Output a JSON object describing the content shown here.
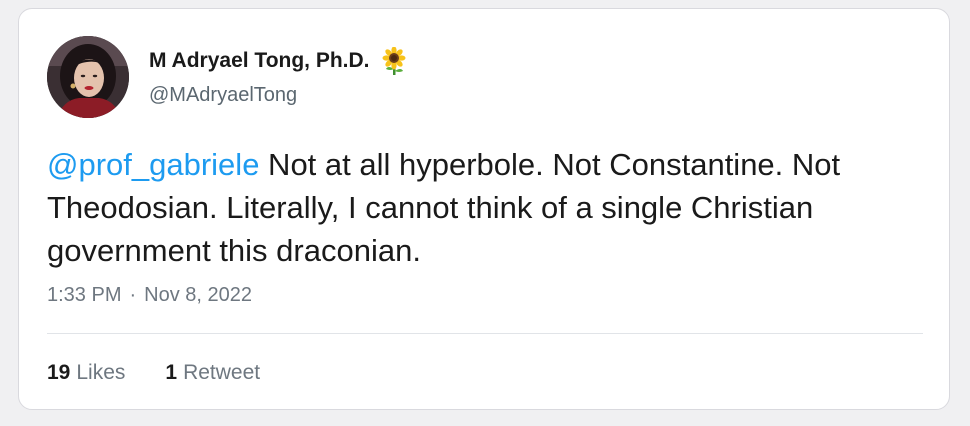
{
  "tweet": {
    "author": {
      "display_name": "M Adryael Tong, Ph.D.",
      "emoji": "sunflower-icon",
      "handle": "@MAdryaelTong"
    },
    "mention": "@prof_gabriele",
    "body": " Not at all hyperbole. Not Constantine. Not Theodosian. Literally, I cannot think of a single Christian government this draconian.",
    "time": "1:33 PM",
    "separator": "·",
    "date": "Nov 8, 2022",
    "stats": {
      "likes_count": "19",
      "likes_label": "Likes",
      "retweets_count": "1",
      "retweets_label": "Retweet"
    }
  },
  "colors": {
    "mention": "#1d9bf0",
    "secondary_text": "#6e7780",
    "primary_text": "#1a1a1a"
  }
}
